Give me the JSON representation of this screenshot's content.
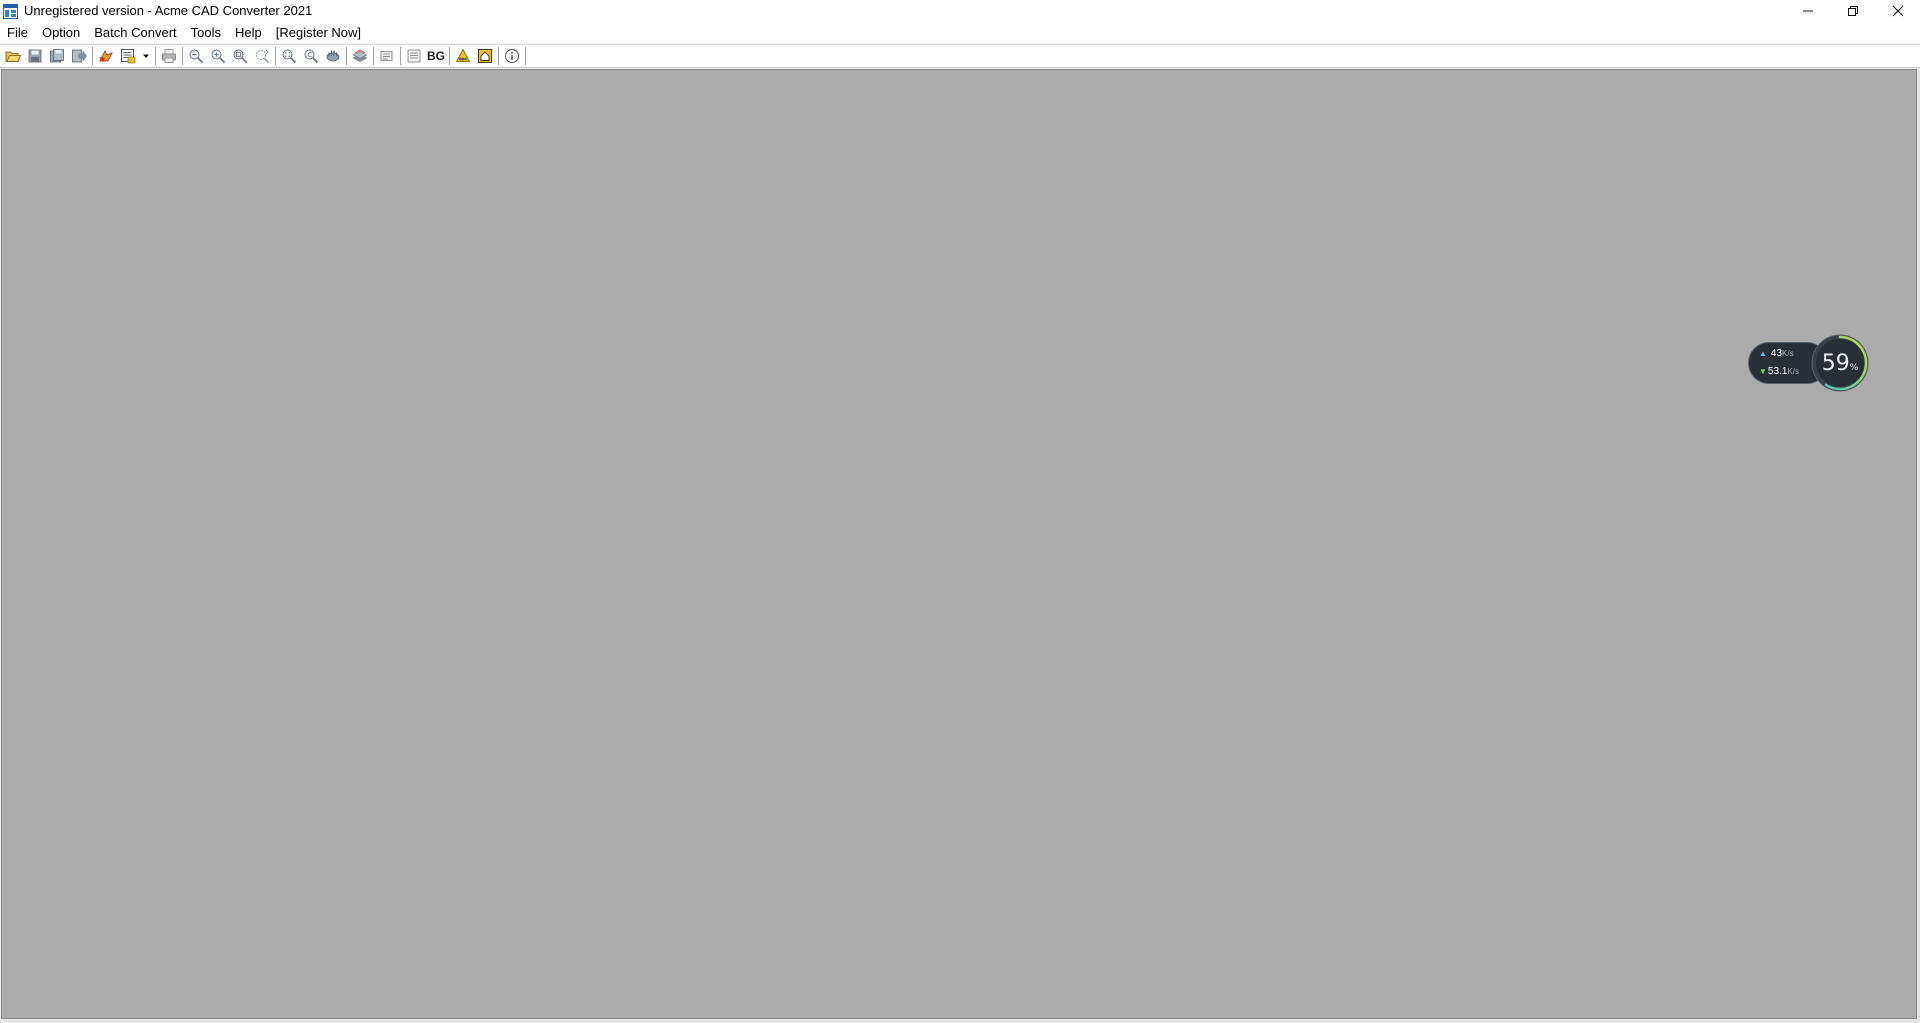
{
  "window": {
    "title": "Unregistered version - Acme CAD Converter 2021",
    "controls": {
      "minimize": "─",
      "restore": "❐",
      "close": "✕"
    }
  },
  "menubar": {
    "items": [
      {
        "label": "File"
      },
      {
        "label": "Option"
      },
      {
        "label": "Batch Convert"
      },
      {
        "label": "Tools"
      },
      {
        "label": "Help"
      },
      {
        "label": "[Register Now]"
      }
    ]
  },
  "toolbar": {
    "bg_label": "BG",
    "icons": [
      "open-folder-icon",
      "save-icon",
      "save-as-icon",
      "export-icon",
      "convert-icon",
      "batch-convert-icon",
      "dropdown-arrow-icon",
      "print-icon",
      "zoom-out-icon",
      "zoom-in-icon",
      "zoom-window-icon",
      "zoom-realtime-icon",
      "zoom-extents-icon",
      "zoom-previous-icon",
      "pan-icon",
      "layers-icon",
      "properties-icon",
      "text-search-icon",
      "background-icon",
      "warning-icon",
      "home-icon",
      "info-icon"
    ]
  },
  "net_widget": {
    "upload_value": "43",
    "upload_unit": "K/s",
    "download_value": "53.1",
    "download_unit": "K/s",
    "usage_percent": "59",
    "percent_sign": "%",
    "usage_fraction": 0.59,
    "ring_color": "#3fc3c8",
    "ring_color_end": "#c8d84a"
  },
  "colors": {
    "canvas": "#ababab",
    "titlebar": "#ffffff"
  }
}
